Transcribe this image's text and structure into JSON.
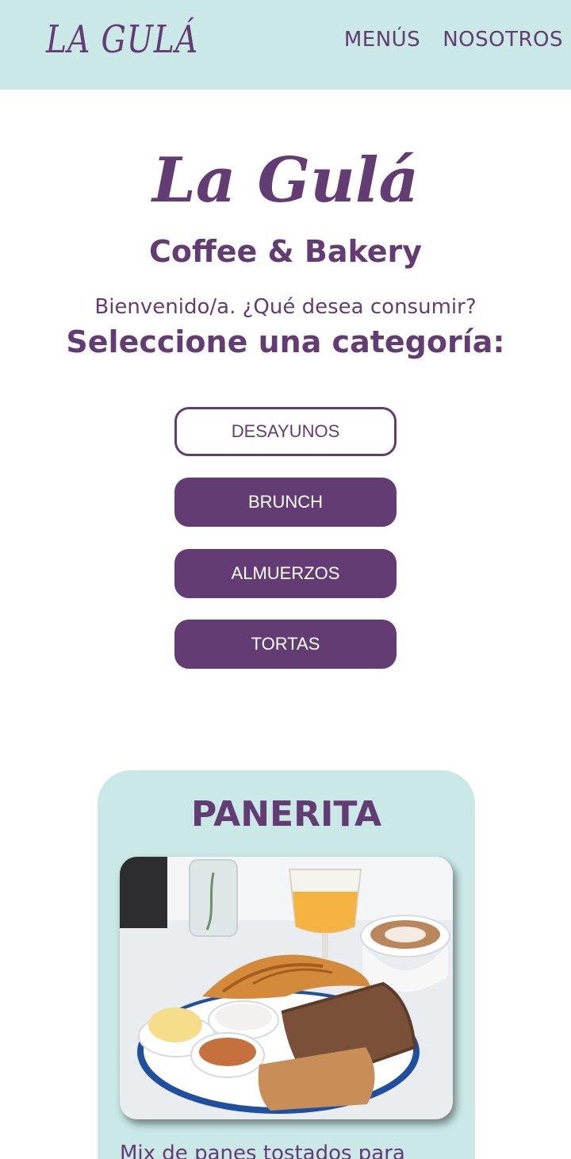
{
  "nav": {
    "logo": "LA GULÁ",
    "links": [
      "MENÚS",
      "NOSOTROS"
    ]
  },
  "hero": {
    "title": "La Gulá",
    "subtitle": "Coffee & Bakery",
    "welcome": "Bienvenido/a. ¿Qué desea consumir?",
    "select_heading": "Seleccione una categoría:"
  },
  "categories": [
    {
      "label": "DESAYUNOS",
      "active": true
    },
    {
      "label": "BRUNCH",
      "active": false
    },
    {
      "label": "ALMUERZOS",
      "active": false
    },
    {
      "label": "TORTAS",
      "active": false
    }
  ],
  "product": {
    "title": "PANERITA",
    "description": "Mix de panes tostados para"
  },
  "colors": {
    "brand_purple": "#643c74",
    "mint": "#c9e8e6",
    "white": "#ffffff"
  }
}
